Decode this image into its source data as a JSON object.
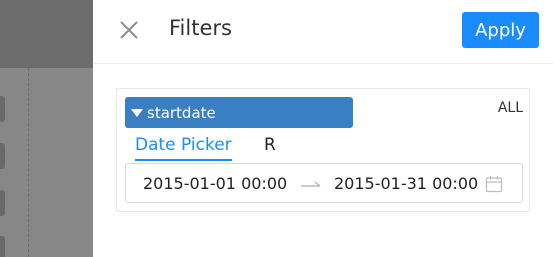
{
  "drawer": {
    "title": "Filters",
    "apply_label": "Apply",
    "close_icon": "close-icon"
  },
  "filter": {
    "field_name": "startdate",
    "scope_label": "ALL",
    "tabs": [
      {
        "label": "Date Picker",
        "active": true
      },
      {
        "label": "R",
        "active": false
      }
    ],
    "start_value": "2015-01-01 00:00:00",
    "end_value": "2015-01-31 00:00:00",
    "separator_icon": "arrow-right-icon",
    "calendar_icon": "calendar-icon"
  },
  "colors": {
    "accent": "#1a8cff",
    "field_tag": "#3a7fc1",
    "backdrop": "#7f7f7f"
  }
}
